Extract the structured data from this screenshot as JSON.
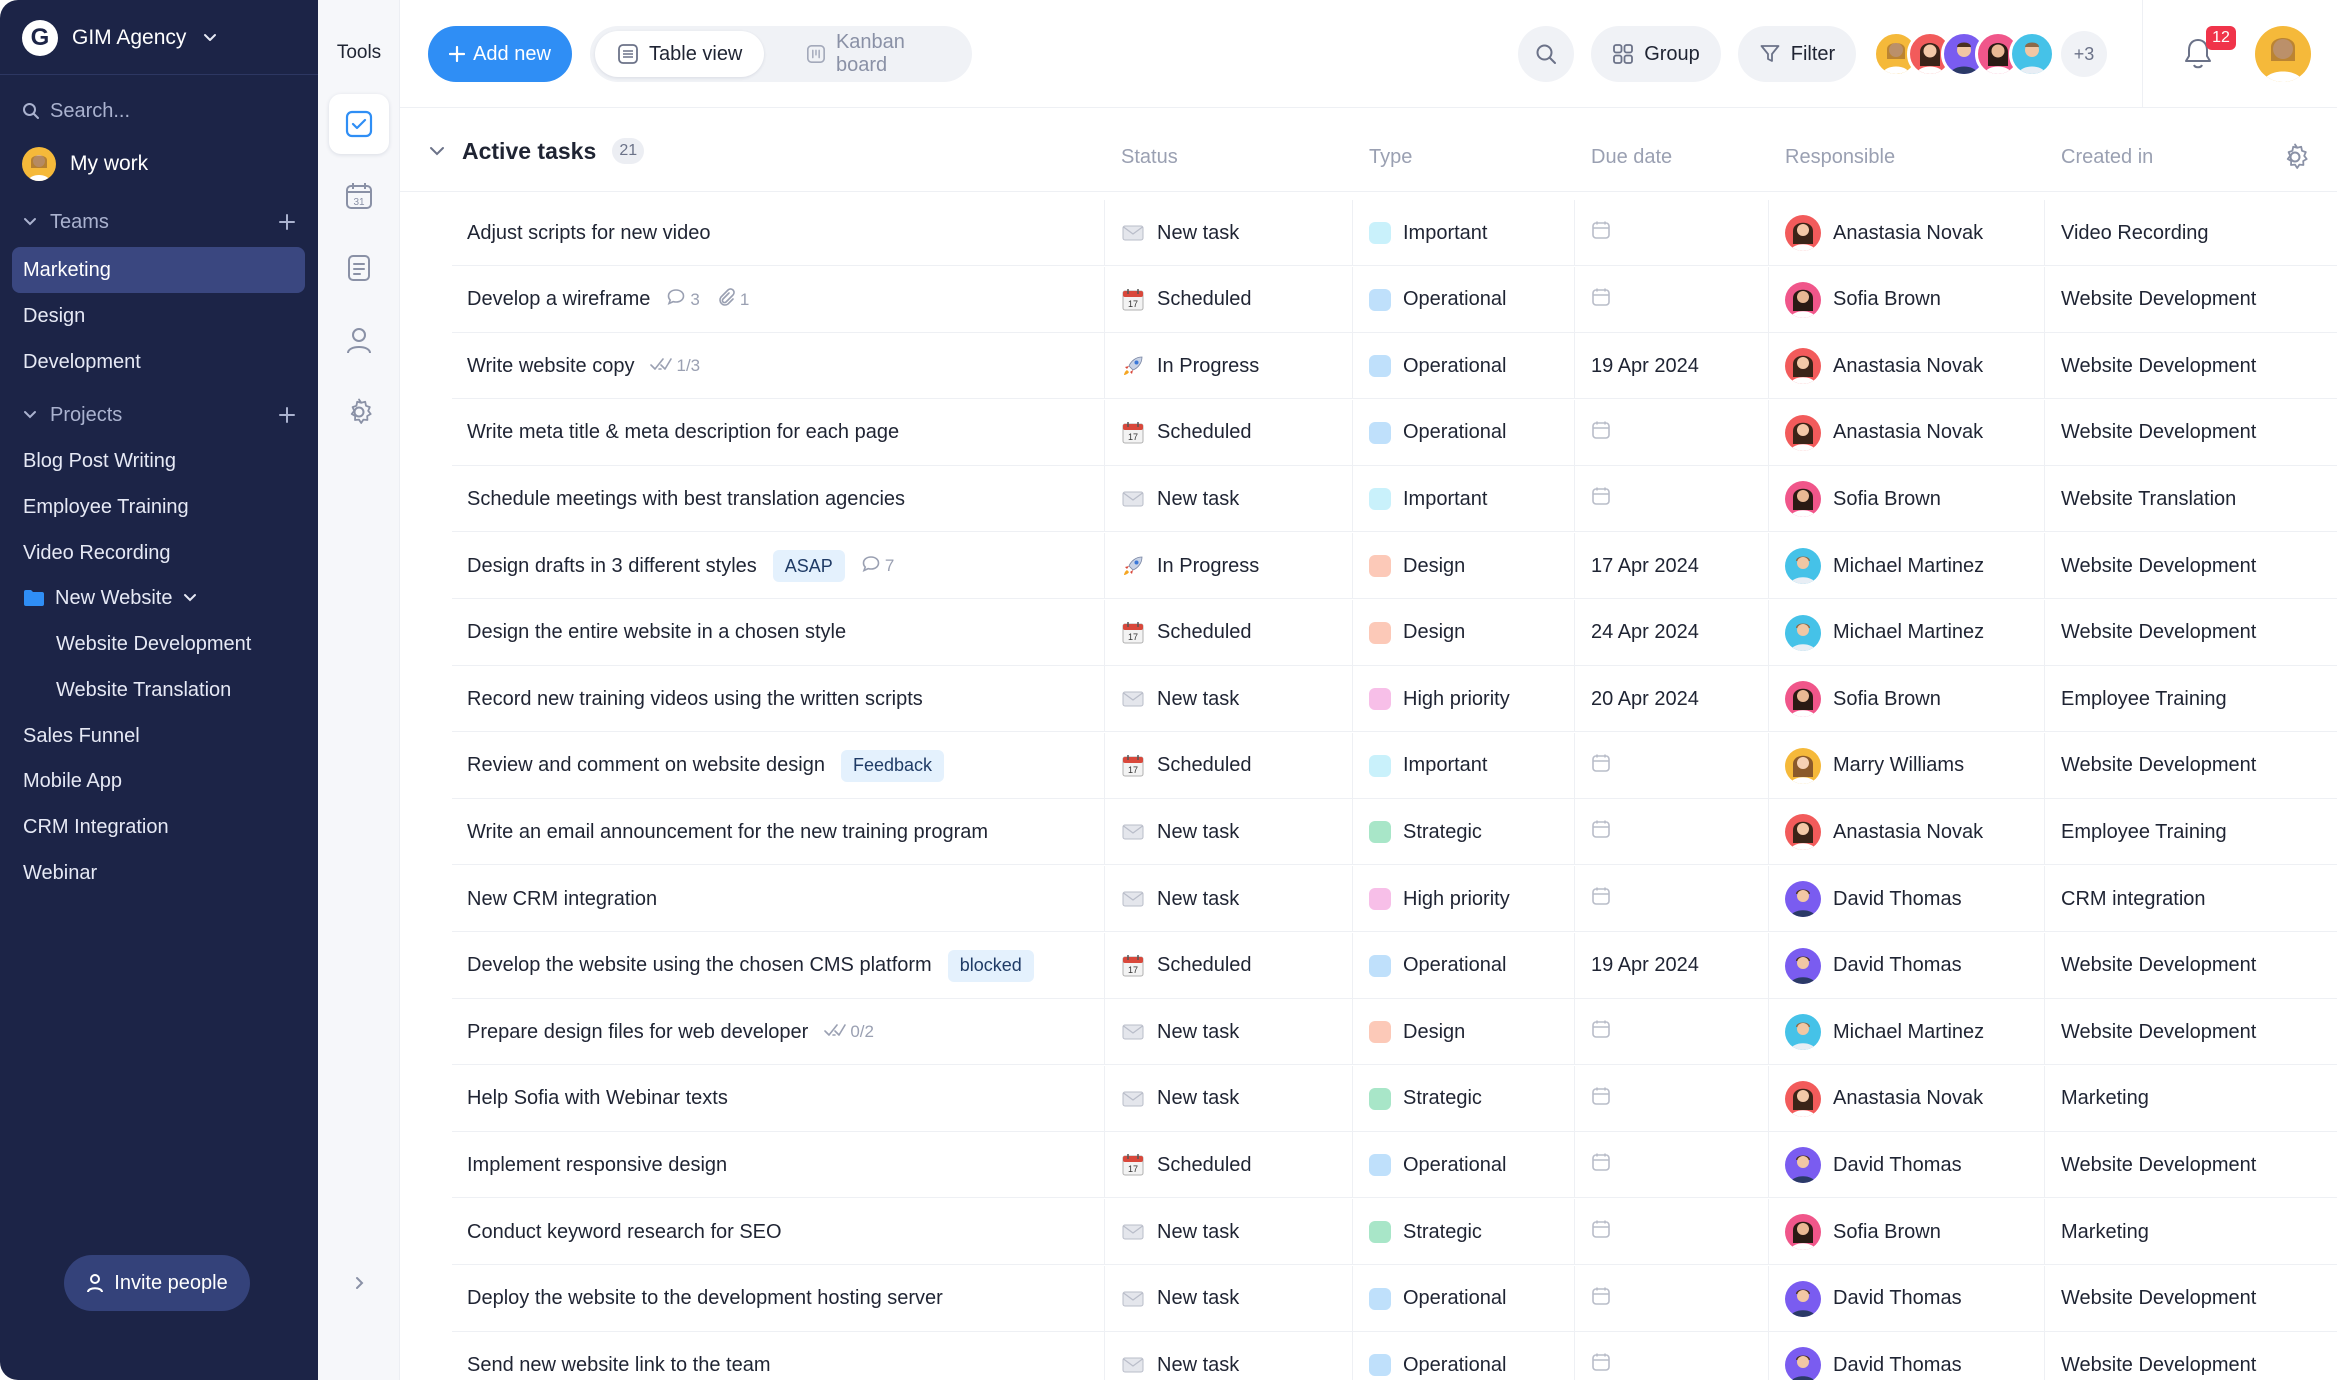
{
  "workspace": {
    "name": "GIM Agency",
    "logo_letter": "G"
  },
  "sidebar": {
    "search_placeholder": "Search...",
    "my_work": "My work",
    "teams_label": "Teams",
    "teams": [
      {
        "label": "Marketing",
        "active": true
      },
      {
        "label": "Design"
      },
      {
        "label": "Development"
      }
    ],
    "projects_label": "Projects",
    "projects": [
      {
        "label": "Blog Post Writing"
      },
      {
        "label": "Employee Training"
      },
      {
        "label": "Video Recording"
      },
      {
        "label": "New Website",
        "folder": true
      },
      {
        "label": "Website Development",
        "sub": true
      },
      {
        "label": "Website Translation",
        "sub": true
      },
      {
        "label": "Sales Funnel"
      },
      {
        "label": "Mobile App"
      },
      {
        "label": "CRM Integration"
      },
      {
        "label": "Webinar"
      }
    ],
    "invite_label": "Invite people"
  },
  "tools": {
    "title": "Tools",
    "items": [
      "checkbox-icon",
      "calendar-icon",
      "notes-icon",
      "user-icon",
      "settings-icon"
    ],
    "calendar_day": "31"
  },
  "toolbar": {
    "add_label": "Add new",
    "table_view": "Table view",
    "kanban_board": "Kanban board",
    "group_label": "Group",
    "filter_label": "Filter",
    "more_members": "+3",
    "notifications": "12"
  },
  "colors": {
    "sidebar_bg": "#1c2447",
    "accent": "#2f8ef5",
    "badge": "#f0344a",
    "type_important": "#c9f1fb",
    "type_operational": "#bfe0fb",
    "type_design": "#fcc9b8",
    "type_high_priority": "#f7bfe8",
    "type_strategic": "#a8e6c8"
  },
  "table": {
    "group_title": "Active tasks",
    "group_count": "21",
    "columns": {
      "status": "Status",
      "type": "Type",
      "due": "Due date",
      "responsible": "Responsible",
      "created": "Created in"
    },
    "rows": [
      {
        "task": "Adjust scripts for new video",
        "status": "New task",
        "type": "Important",
        "due": "",
        "resp": "Anastasia Novak",
        "proj": "Video Recording"
      },
      {
        "task": "Develop a wireframe",
        "comments": "3",
        "attachments": "1",
        "status": "Scheduled",
        "type": "Operational",
        "due": "",
        "resp": "Sofia Brown",
        "proj": "Website Development"
      },
      {
        "task": "Write website copy",
        "checklist": "1/3",
        "status": "In Progress",
        "type": "Operational",
        "due": "19 Apr 2024",
        "resp": "Anastasia Novak",
        "proj": "Website Development"
      },
      {
        "task": "Write meta title & meta description for each page",
        "status": "Scheduled",
        "type": "Operational",
        "due": "",
        "resp": "Anastasia Novak",
        "proj": "Website Development"
      },
      {
        "task": "Schedule meetings with best translation agencies",
        "status": "New task",
        "type": "Important",
        "due": "",
        "resp": "Sofia Brown",
        "proj": "Website Translation"
      },
      {
        "task": "Design drafts in 3 different styles",
        "tag": "ASAP",
        "comments": "7",
        "status": "In Progress",
        "type": "Design",
        "due": "17 Apr 2024",
        "resp": "Michael Martinez",
        "proj": "Website Development"
      },
      {
        "task": "Design the entire website in a chosen style",
        "status": "Scheduled",
        "type": "Design",
        "due": "24 Apr 2024",
        "resp": "Michael Martinez",
        "proj": "Website Development"
      },
      {
        "task": "Record new training videos using the written scripts",
        "status": "New task",
        "type": "High priority",
        "due": "20 Apr 2024",
        "resp": "Sofia Brown",
        "proj": "Employee Training"
      },
      {
        "task": "Review and comment on website design",
        "tag": "Feedback",
        "status": "Scheduled",
        "type": "Important",
        "due": "",
        "resp": "Marry Williams",
        "proj": "Website Development"
      },
      {
        "task": "Write an email announcement for the new training program",
        "status": "New task",
        "type": "Strategic",
        "due": "",
        "resp": "Anastasia Novak",
        "proj": "Employee Training"
      },
      {
        "task": "New CRM integration",
        "status": "New task",
        "type": "High priority",
        "due": "",
        "resp": "David Thomas",
        "proj": "CRM integration"
      },
      {
        "task": "Develop the website using the chosen CMS platform",
        "tag": "blocked",
        "status": "Scheduled",
        "type": "Operational",
        "due": "19 Apr 2024",
        "resp": "David Thomas",
        "proj": "Website Development"
      },
      {
        "task": "Prepare design files for web developer",
        "checklist": "0/2",
        "status": "New task",
        "type": "Design",
        "due": "",
        "resp": "Michael Martinez",
        "proj": "Website Development"
      },
      {
        "task": "Help Sofia with Webinar texts",
        "status": "New task",
        "type": "Strategic",
        "due": "",
        "resp": "Anastasia Novak",
        "proj": "Marketing"
      },
      {
        "task": "Implement responsive design",
        "status": "Scheduled",
        "type": "Operational",
        "due": "",
        "resp": "David Thomas",
        "proj": "Website Development"
      },
      {
        "task": "Conduct keyword research for SEO",
        "status": "New task",
        "type": "Strategic",
        "due": "",
        "resp": "Sofia Brown",
        "proj": "Marketing"
      },
      {
        "task": "Deploy the website to the development hosting server",
        "status": "New task",
        "type": "Operational",
        "due": "",
        "resp": "David Thomas",
        "proj": "Website Development"
      },
      {
        "task": "Send new website link to the team",
        "status": "New task",
        "type": "Operational",
        "due": "",
        "resp": "David Thomas",
        "proj": "Website Development"
      }
    ]
  }
}
